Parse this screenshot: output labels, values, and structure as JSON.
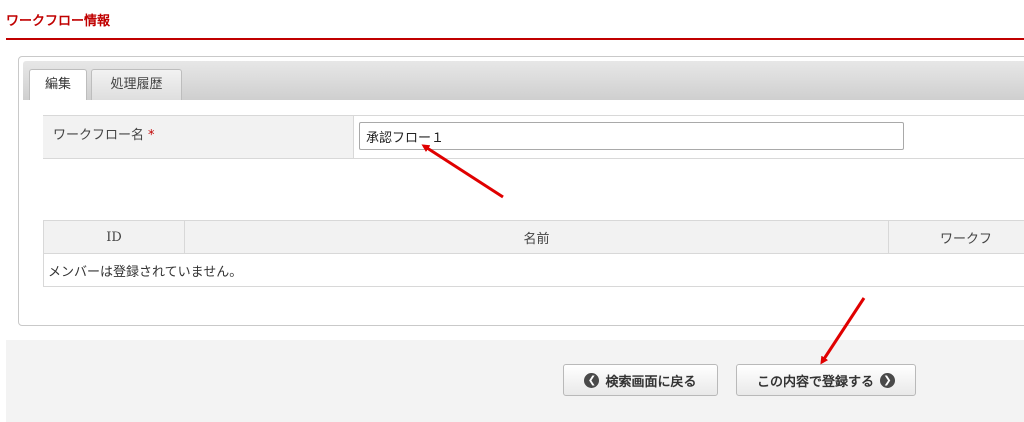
{
  "header": {
    "title": "ワークフロー情報"
  },
  "tabs": [
    {
      "label": "編集",
      "active": true
    },
    {
      "label": "処理履歴",
      "active": false
    }
  ],
  "form": {
    "name_label": "ワークフロー名",
    "required_mark": "*",
    "name_value": "承認フロー１"
  },
  "members_table": {
    "columns": [
      "ID",
      "名前",
      "ワークフ"
    ],
    "empty_message": "メンバーは登録されていません。"
  },
  "buttons": {
    "back_label": "検索画面に戻る",
    "back_icon": "chevron-left-circle-icon",
    "register_label": "この内容で登録する",
    "register_icon": "chevron-right-circle-icon"
  },
  "colors": {
    "accent": "#c00000",
    "annotation_arrow": "#e00000"
  }
}
